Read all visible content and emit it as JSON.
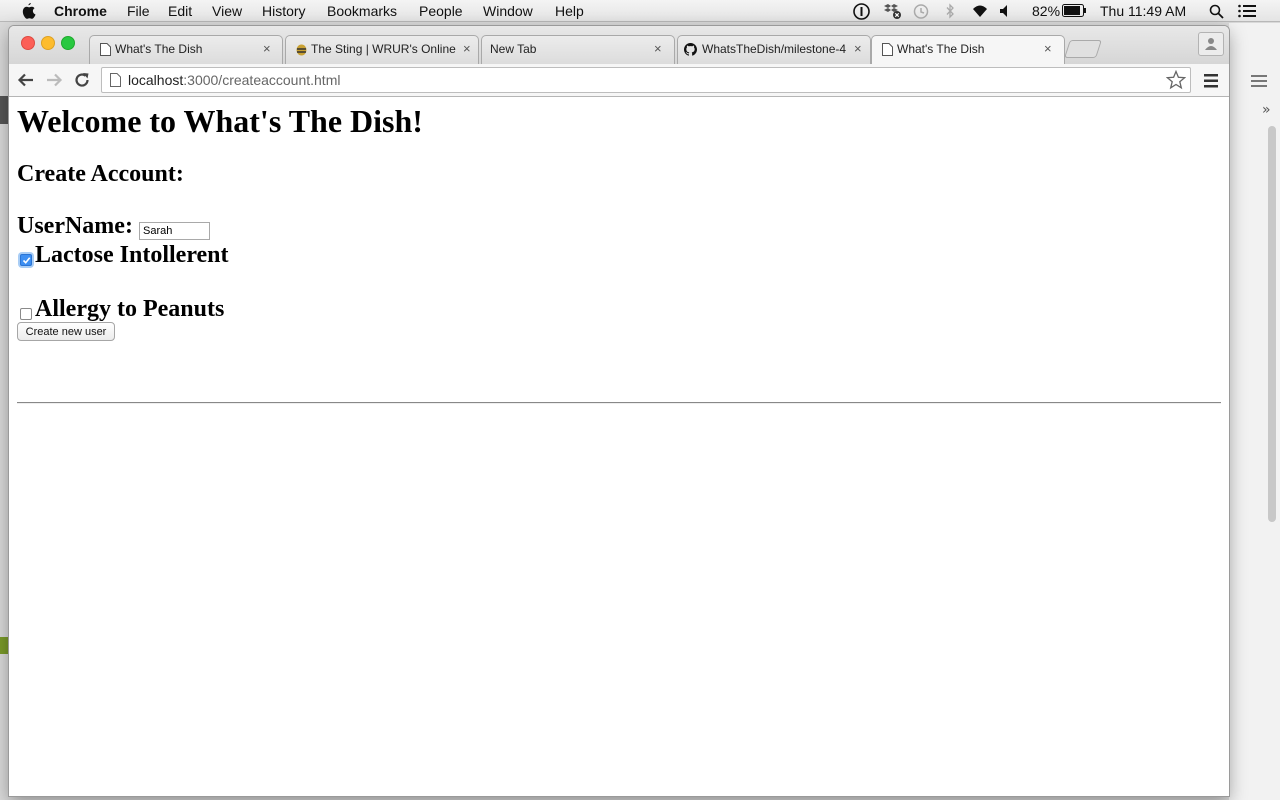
{
  "menubar": {
    "app_name": "Chrome",
    "items": [
      "File",
      "Edit",
      "View",
      "History",
      "Bookmarks",
      "People",
      "Window",
      "Help"
    ],
    "battery": "82%",
    "clock": "Thu 11:49 AM"
  },
  "tabs": [
    {
      "title": "What's The Dish",
      "favicon": "page-icon"
    },
    {
      "title": "The Sting | WRUR's Online",
      "favicon": "bee-icon"
    },
    {
      "title": "New Tab",
      "favicon": ""
    },
    {
      "title": "WhatsTheDish/milestone-4",
      "favicon": "github-icon"
    },
    {
      "title": "What's The Dish",
      "favicon": "page-icon",
      "active": true
    }
  ],
  "address_bar": {
    "host": "localhost",
    "path": ":3000/createaccount.html"
  },
  "page": {
    "heading": "Welcome to What's The Dish!",
    "subheading": "Create Account:",
    "username_label": "UserName:",
    "username_value": "Sarah",
    "options": [
      {
        "label": "Lactose Intollerent",
        "checked": true
      },
      {
        "label": "Allergy to Peanuts",
        "checked": false
      }
    ],
    "submit_label": "Create new user"
  }
}
